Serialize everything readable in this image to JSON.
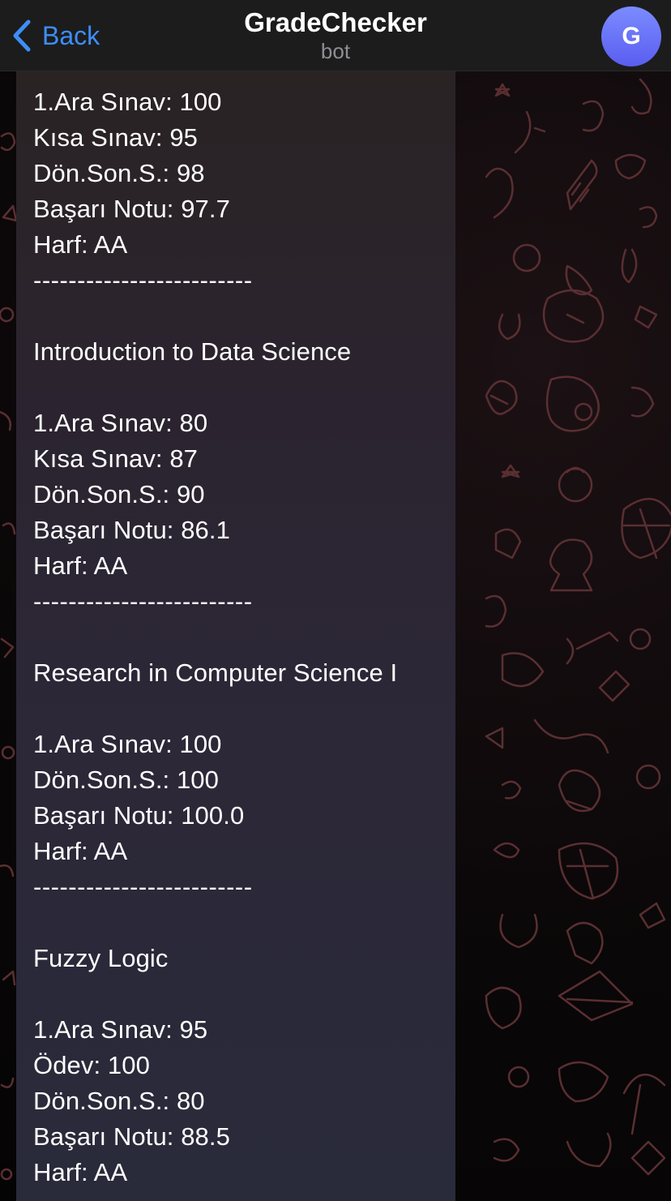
{
  "header": {
    "back_label": "Back",
    "title": "GradeChecker",
    "subtitle": "bot",
    "avatar_letter": "G"
  },
  "message": {
    "lines": [
      "1.Ara Sınav: 100",
      "Kısa Sınav: 95",
      "Dön.Son.S.: 98",
      "Başarı Notu: 97.7",
      "Harf: AA",
      "-------------------------",
      "",
      "Introduction to Data Science",
      "",
      "1.Ara Sınav: 80",
      "Kısa Sınav: 87",
      "Dön.Son.S.: 90",
      "Başarı Notu: 86.1",
      "Harf: AA",
      "-------------------------",
      "",
      "Research in Computer Science I",
      "",
      "1.Ara Sınav: 100",
      "Dön.Son.S.: 100",
      "Başarı Notu: 100.0",
      "Harf: AA",
      "-------------------------",
      "",
      "Fuzzy Logic",
      "",
      "1.Ara Sınav: 95",
      "Ödev: 100",
      "Dön.Son.S.: 80",
      "Başarı Notu: 88.5",
      "Harf: AA"
    ]
  },
  "colors": {
    "accent": "#3e8ef7",
    "header_bg": "#1c1c1d",
    "bubble_bg": "#2b2632",
    "doodle": "#5a2f32",
    "avatar": "#6a70f5"
  },
  "icons": [
    "chevron-left-icon",
    "chat-wallpaper-doodles"
  ]
}
